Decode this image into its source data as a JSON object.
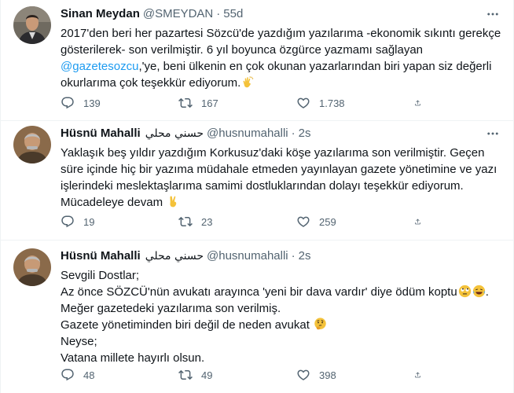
{
  "tweets": [
    {
      "name": "Sinan Meydan",
      "name_ar": "",
      "handle": "@SMEYDAN",
      "dot": "·",
      "time": "55d",
      "lines": [
        "2017'den beri her pazartesi Sözcü'de yazdığım yazılarıma -ekonomik sıkıntı gerekçe",
        "gösterilerek- son verilmiştir. 6 yıl boyunca özgürce yazmamı sağlayan",
        "@gazetesozcu",
        ",'ye, beni ülkenin en çok okunan yazarlarından biri yapan siz değerli",
        "okurlarıma çok teşekkür ediyorum."
      ],
      "emoji": "clapping-hands",
      "replies": "139",
      "retweets": "167",
      "likes": "1.738"
    },
    {
      "name": "Hüsnü Mahalli",
      "name_ar": "حسني محلي",
      "handle": "@husnumahalli",
      "dot": "·",
      "time": "2s",
      "lines": [
        "Yaklaşık beş yıldır yazdığım Korkusuz'daki köşe yazılarıma son verilmiştir. Geçen",
        "süre içinde hiç bir yazıma müdahale etmeden yayınlayan gazete yönetimine ve yazı",
        "işlerindeki meslektaşlarıma samimi dostluklarından dolayı teşekkür ediyorum.",
        "Mücadeleye devam"
      ],
      "emoji": "victory-hand",
      "replies": "19",
      "retweets": "23",
      "likes": "259"
    },
    {
      "name": "Hüsnü Mahalli",
      "name_ar": "حسني محلي",
      "handle": "@husnumahalli",
      "dot": "·",
      "time": "2s",
      "lines": [
        "Sevgili Dostlar;",
        "Az önce SÖZCÜ'nün avukatı arayınca 'yeni bir dava vardır' diye ödüm koptu",
        ".",
        "Meğer gazetedeki yazılarıma son verilmiş.",
        "Gazete yönetiminden biri değil de neden avukat",
        "Neyse;",
        "Vatana millete hayırlı olsun."
      ],
      "emoji": [
        "rolling-eyes",
        "crying-laughing",
        "thinking-face"
      ],
      "replies": "48",
      "retweets": "49",
      "likes": "398"
    }
  ],
  "colors": {
    "text": "#0f1419",
    "muted": "#536471",
    "link": "#1d9bf0",
    "border": "#eff3f4"
  }
}
